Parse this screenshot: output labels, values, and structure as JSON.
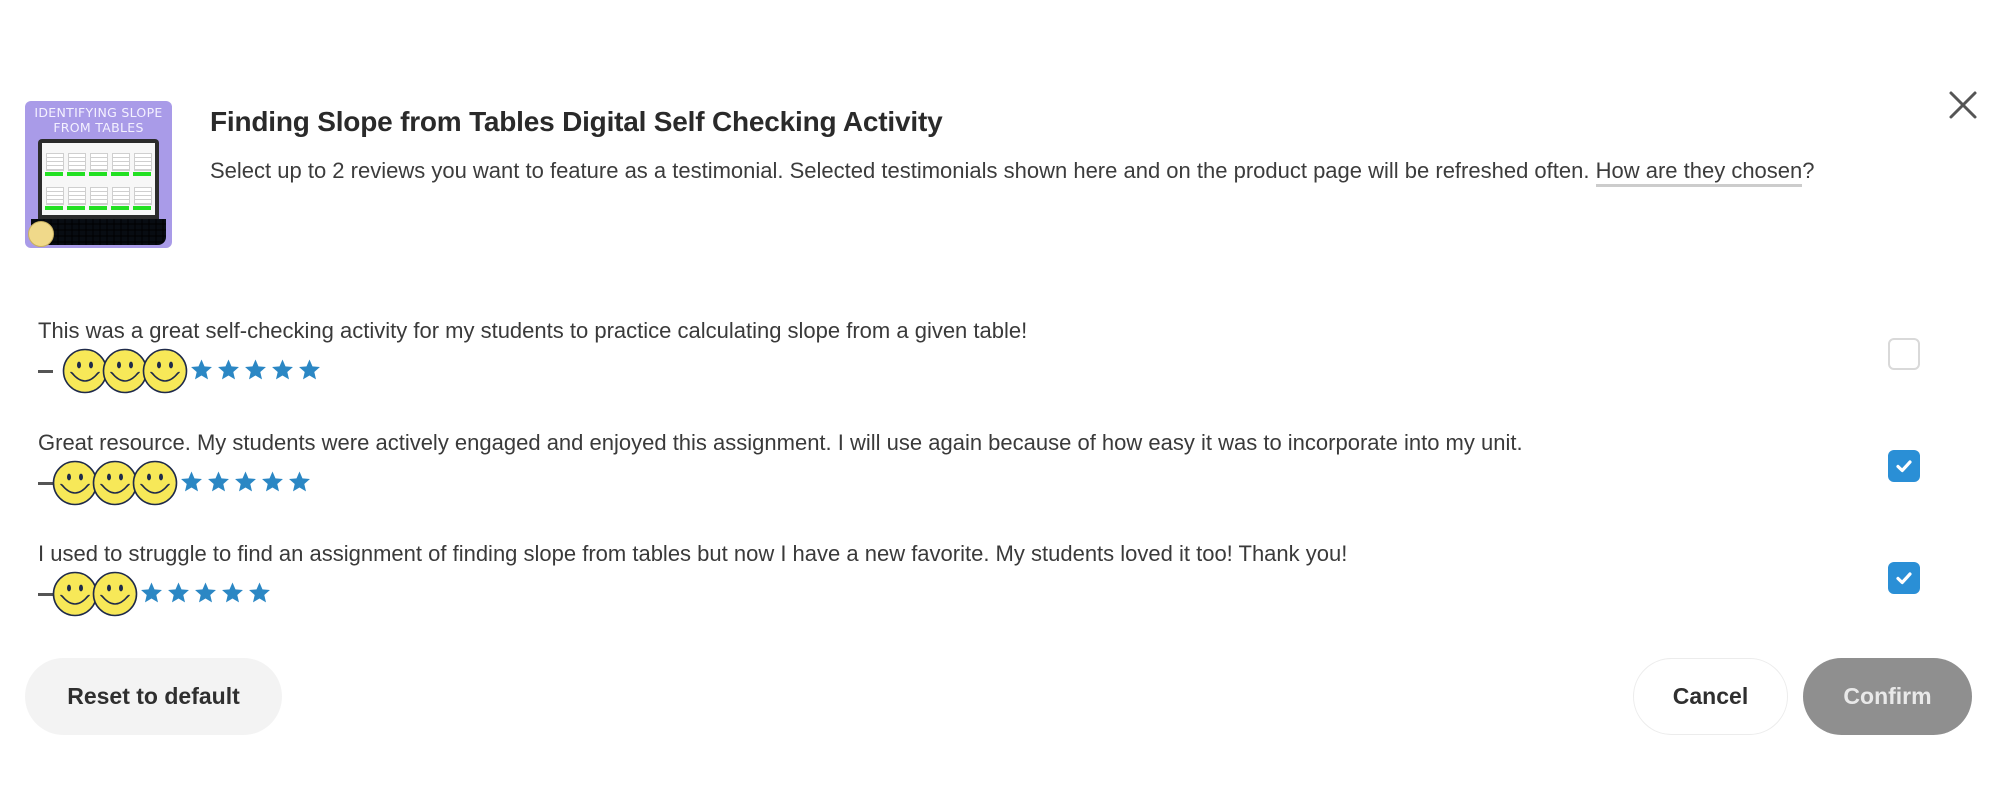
{
  "dialog": {
    "product_thumbnail": {
      "title_line1": "IDENTIFYING SLOPE",
      "title_line2": "FROM TABLES"
    },
    "title": "Finding Slope from Tables Digital Self Checking Activity",
    "subtitle": "Select up to 2 reviews you want to feature as a testimonial. Selected testimonials shown here and on the product page will be refreshed often. ",
    "subtitle_link": "How are they chosen",
    "subtitle_link_suffix": "?",
    "close_icon": "close-icon",
    "max_selections": 2
  },
  "reviews": [
    {
      "text": "This was a great self-checking activity for my students to practice calculating slope from a given table!",
      "attribution_prefix": "—",
      "redacted_name_icons": 3,
      "rating": 5,
      "rating_max": 5,
      "selected": false
    },
    {
      "text": "Great resource. My students were actively engaged and enjoyed this assignment. I will use again because of how easy it was to incorporate into my unit.",
      "attribution_prefix": "—",
      "redacted_name_icons": 3,
      "rating": 5,
      "rating_max": 5,
      "selected": true
    },
    {
      "text": "I used to struggle to find an assignment of finding slope from tables but now I have a new favorite. My students loved it too! Thank you!",
      "attribution_prefix": "—",
      "redacted_name_icons": 2,
      "rating": 5,
      "rating_max": 5,
      "selected": true
    }
  ],
  "footer": {
    "reset_label": "Reset to default",
    "cancel_label": "Cancel",
    "confirm_label": "Confirm",
    "confirm_enabled": false
  },
  "colors": {
    "star": "#2b87c4",
    "checkbox_checked": "#2a8fd6",
    "confirm_disabled_bg": "#8f8f8f",
    "reset_bg": "#f3f3f3",
    "thumbnail_bg": "#a99be8",
    "smiley_fill": "#f7e858"
  }
}
